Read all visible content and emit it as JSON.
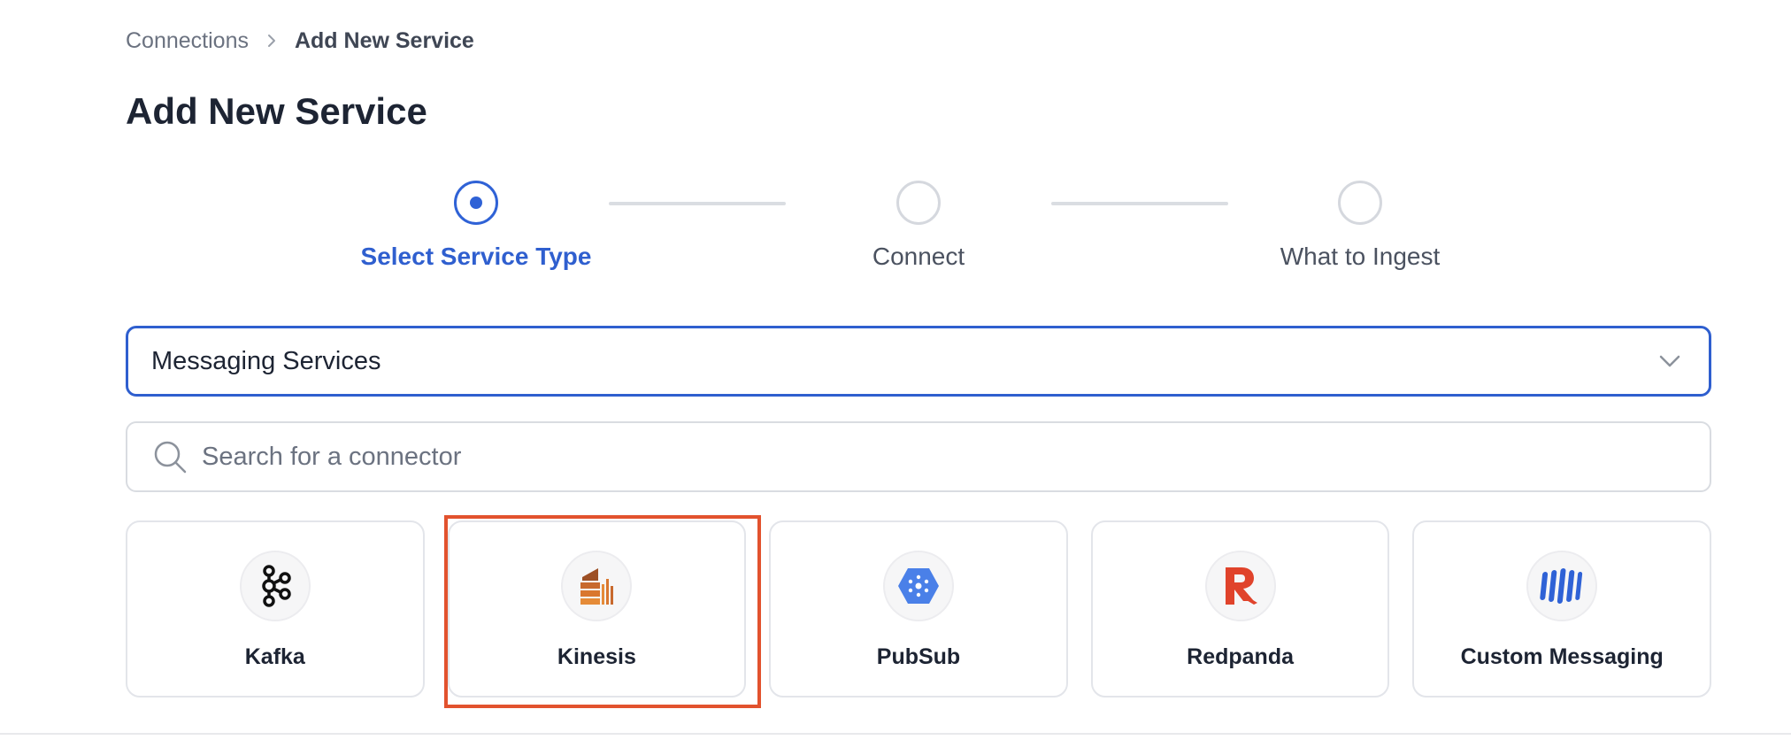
{
  "breadcrumb": {
    "parent": "Connections",
    "current": "Add New Service"
  },
  "page": {
    "title": "Add New Service"
  },
  "stepper": {
    "steps": [
      {
        "label": "Select Service Type",
        "state": "active"
      },
      {
        "label": "Connect",
        "state": "pending"
      },
      {
        "label": "What to Ingest",
        "state": "pending"
      }
    ]
  },
  "service_type_select": {
    "value": "Messaging Services"
  },
  "search": {
    "placeholder": "Search for a connector",
    "value": ""
  },
  "connectors": [
    {
      "label": "Kafka",
      "icon": "kafka-icon"
    },
    {
      "label": "Kinesis",
      "icon": "kinesis-icon",
      "selected": true
    },
    {
      "label": "PubSub",
      "icon": "pubsub-icon"
    },
    {
      "label": "Redpanda",
      "icon": "redpanda-icon"
    },
    {
      "label": "Custom Messaging",
      "icon": "custom-messaging-icon"
    }
  ],
  "colors": {
    "accent": "#2f5fcf",
    "highlight": "#e2522e",
    "border": "#e3e5ea"
  }
}
